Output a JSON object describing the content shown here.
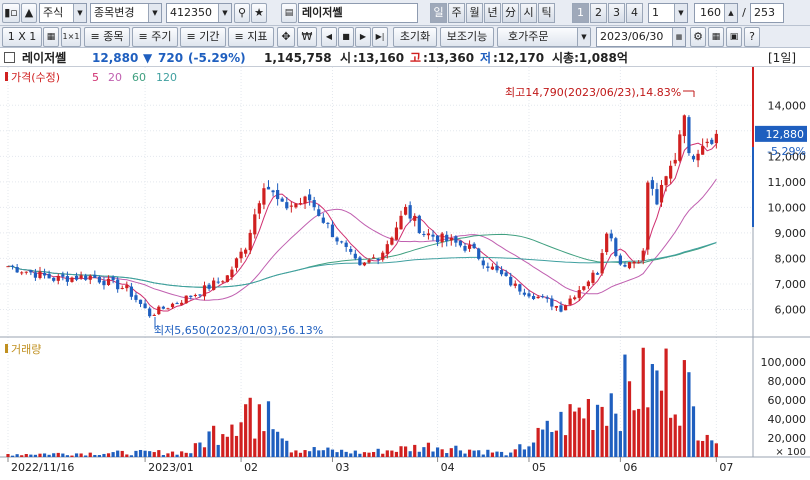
{
  "toolbar": {
    "market_select": "주식",
    "change_button": "종목변경",
    "code": "412350",
    "name": "레이저쎌",
    "periods": [
      "일",
      "주",
      "월",
      "년",
      "分",
      "시",
      "틱"
    ],
    "period_selected": "일",
    "numbers": [
      "1",
      "2",
      "3",
      "4"
    ],
    "number_selected": "1",
    "interval_value": "1",
    "count_value": "160",
    "page_sep": "/",
    "page_total": "253",
    "scale_label": "1 X 1",
    "tb2_items": [
      "≡ 종목",
      "≡ 주기",
      "≡ 기간",
      "≡ 지표"
    ],
    "won_label": "₩",
    "reset_button": "초기화",
    "aux_button": "보조기능",
    "quote_button": "호가주문",
    "date_value": "2023/06/30"
  },
  "info": {
    "name": "레이저쎌",
    "price": "12,880",
    "arrow": "▼",
    "change": "720",
    "change_pct": "(-5.29%)",
    "volume": "1,145,758",
    "open_label": "시",
    "open": ":13,160",
    "high_label": "고",
    "high": ":13,360",
    "low_label": "저",
    "low": ":12,170",
    "mcap": "시총:1,088억",
    "period_tag": "[1일]"
  },
  "price_panel": {
    "legend": [
      "가격(수정)",
      "5",
      "20",
      "60",
      "120"
    ],
    "max_annotation": "최고14,790(2023/06/23),14.83%",
    "min_annotation": "최저5,650(2023/01/03),56.13%",
    "current_price_tag": "12,880",
    "current_pct_tag": "-5.29%"
  },
  "volume_panel": {
    "legend": "거래량"
  },
  "colors": {
    "up": "#d02020",
    "down": "#1f5fbf",
    "ma5": "#d03070",
    "ma20": "#c060b0",
    "ma60": "#40a080",
    "ma120": "#40a0a0"
  },
  "chart_data": {
    "type": "candlestick",
    "title": "레이저쎌",
    "xlabel": "",
    "ylabel": "",
    "price_axis": {
      "ylim": [
        5000,
        15500
      ],
      "ticks": [
        6000,
        7000,
        8000,
        9000,
        10000,
        11000,
        12000,
        13000,
        14000
      ],
      "tick_labels": [
        "6,000",
        "7,000",
        "8,000",
        "9,000",
        "10,000",
        "11,000",
        "12,000",
        "13,000",
        "14,000"
      ]
    },
    "volume_axis": {
      "ylim": [
        0,
        120000
      ],
      "ticks": [
        20000,
        40000,
        60000,
        80000,
        100000
      ],
      "tick_labels": [
        "20,000",
        "40,000",
        "60,000",
        "80,000",
        "100,000"
      ],
      "unit": "× 100"
    },
    "x_ticks": [
      {
        "label": "2022/11/16",
        "x": 0
      },
      {
        "label": "2023/01",
        "x": 30
      },
      {
        "label": "02",
        "x": 51
      },
      {
        "label": "03",
        "x": 71
      },
      {
        "label": "04",
        "x": 94
      },
      {
        "label": "05",
        "x": 114
      },
      {
        "label": "06",
        "x": 134
      },
      {
        "label": "07",
        "x": 155
      }
    ],
    "price_anchors": [
      [
        0,
        7700
      ],
      [
        10,
        7200
      ],
      [
        18,
        7300
      ],
      [
        26,
        6800
      ],
      [
        31,
        5800
      ],
      [
        42,
        6700
      ],
      [
        48,
        7300
      ],
      [
        52,
        8500
      ],
      [
        56,
        11000
      ],
      [
        60,
        10000
      ],
      [
        66,
        10300
      ],
      [
        71,
        9000
      ],
      [
        77,
        7600
      ],
      [
        82,
        8300
      ],
      [
        87,
        9900
      ],
      [
        91,
        9000
      ],
      [
        96,
        8700
      ],
      [
        101,
        8400
      ],
      [
        106,
        7600
      ],
      [
        111,
        6900
      ],
      [
        117,
        6400
      ],
      [
        121,
        6050
      ],
      [
        126,
        7000
      ],
      [
        129,
        7500
      ],
      [
        131,
        9200
      ],
      [
        134,
        7800
      ],
      [
        137,
        7900
      ],
      [
        139,
        8200
      ],
      [
        140,
        11000
      ],
      [
        142,
        10200
      ],
      [
        146,
        12000
      ],
      [
        148,
        13900
      ],
      [
        149,
        11900
      ],
      [
        152,
        12600
      ],
      [
        155,
        12880
      ]
    ],
    "volume_anchors": [
      [
        0,
        4000
      ],
      [
        40,
        7000
      ],
      [
        53,
        80000
      ],
      [
        54,
        25000
      ],
      [
        57,
        95000
      ],
      [
        62,
        12000
      ],
      [
        78,
        6000
      ],
      [
        93,
        16000
      ],
      [
        110,
        4000
      ],
      [
        131,
        86000
      ],
      [
        137,
        94000
      ],
      [
        138,
        98000
      ],
      [
        144,
        108000
      ],
      [
        148,
        105000
      ],
      [
        150,
        60000
      ],
      [
        153,
        50000
      ],
      [
        155,
        12000
      ]
    ],
    "n_bars": 156,
    "series": [
      {
        "name": "가격(수정)"
      },
      {
        "name": "5"
      },
      {
        "name": "20"
      },
      {
        "name": "60"
      },
      {
        "name": "120"
      },
      {
        "name": "거래량"
      }
    ]
  }
}
